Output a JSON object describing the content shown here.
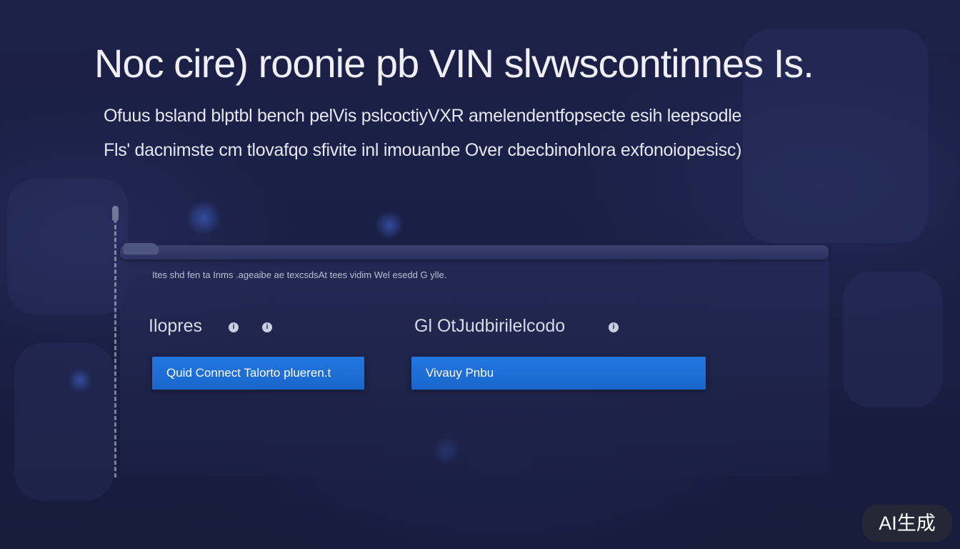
{
  "hero": {
    "headline": "Noc cire) roonie pb VIN slvwscontinnes Is.",
    "description_line1": "Ofuus bsland blptbl bench pelVis pslcoctiyVXR amelendentfopsecte esih leepsodle",
    "description_line2": "Fls' dacnimste cm tlovafqo sfivite inl imouanbe Over cbecbinohlora exfonoiopesisc)"
  },
  "panel": {
    "caption": "Ites shd fen ta Inms .ageaibe ae texcsdsAt tees vidim Wel esedd G ylle.",
    "left_group_label": "Ilopres",
    "right_group_label": "Gl OtJudbirilelcodo",
    "connect_button_label": "Quid Connect Talorto plueren.t",
    "privacy_button_label": "Vivauy Pnbu"
  },
  "badge": {
    "label": "AI生成"
  },
  "colors": {
    "background": "#1b2045",
    "accent_button": "#1f70dc",
    "text": "#e6e9f2"
  },
  "icons": {
    "info": "info-circle-icon"
  }
}
